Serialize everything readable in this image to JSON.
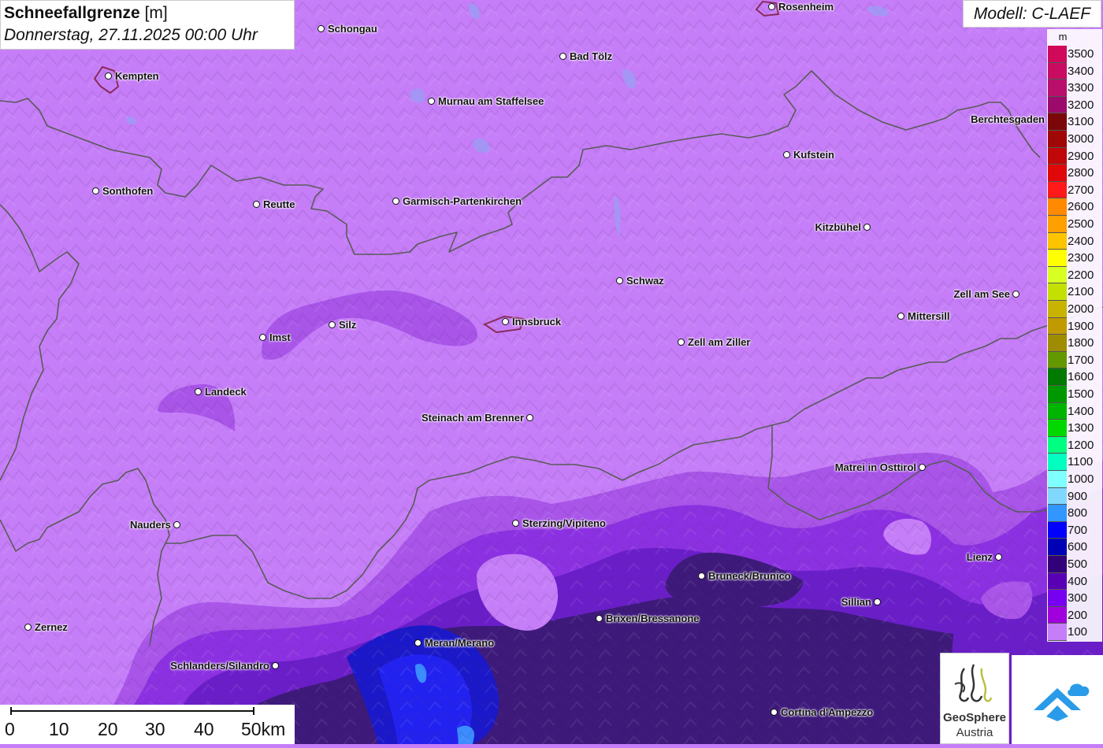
{
  "title": {
    "parameter": "Schneefallgrenze",
    "unit": "[m]",
    "datetime": "Donnerstag, 27.11.2025 00:00 Uhr"
  },
  "model": "Modell: C-LAEF",
  "legend": {
    "unit": "m",
    "entries": [
      {
        "value": "3500",
        "color": "#d1095b"
      },
      {
        "value": "3400",
        "color": "#c80c62"
      },
      {
        "value": "3300",
        "color": "#b80f6a"
      },
      {
        "value": "3200",
        "color": "#9c0b6b"
      },
      {
        "value": "3100",
        "color": "#7a0808"
      },
      {
        "value": "3000",
        "color": "#a00808"
      },
      {
        "value": "2900",
        "color": "#c00808"
      },
      {
        "value": "2800",
        "color": "#e00808"
      },
      {
        "value": "2700",
        "color": "#ff1a1a"
      },
      {
        "value": "2600",
        "color": "#ff8a00"
      },
      {
        "value": "2500",
        "color": "#ffa000"
      },
      {
        "value": "2400",
        "color": "#ffc400"
      },
      {
        "value": "2300",
        "color": "#ffff00"
      },
      {
        "value": "2200",
        "color": "#d8ff22"
      },
      {
        "value": "2100",
        "color": "#c4e000"
      },
      {
        "value": "2000",
        "color": "#c8b400"
      },
      {
        "value": "1900",
        "color": "#c09a00"
      },
      {
        "value": "1800",
        "color": "#a08c00"
      },
      {
        "value": "1700",
        "color": "#649800"
      },
      {
        "value": "1600",
        "color": "#007a00"
      },
      {
        "value": "1500",
        "color": "#009800"
      },
      {
        "value": "1400",
        "color": "#00b400"
      },
      {
        "value": "1300",
        "color": "#00d800"
      },
      {
        "value": "1200",
        "color": "#00ff80"
      },
      {
        "value": "1100",
        "color": "#00ffc0"
      },
      {
        "value": "1000",
        "color": "#80ffff"
      },
      {
        "value": "900",
        "color": "#80d8ff"
      },
      {
        "value": "800",
        "color": "#3296ff"
      },
      {
        "value": "700",
        "color": "#0000ff"
      },
      {
        "value": "600",
        "color": "#0000b4"
      },
      {
        "value": "500",
        "color": "#320078"
      },
      {
        "value": "400",
        "color": "#5a00b4"
      },
      {
        "value": "300",
        "color": "#7800f0"
      },
      {
        "value": "200",
        "color": "#a000dc"
      },
      {
        "value": "100",
        "color": "#c57ef7"
      }
    ]
  },
  "cities": [
    {
      "name": "Rosenheim",
      "dot": [
        980,
        9
      ],
      "label_side": "right"
    },
    {
      "name": "Schongau",
      "dot": [
        408,
        37
      ],
      "label_side": "right"
    },
    {
      "name": "Kempten",
      "dot": [
        138,
        97
      ],
      "label_side": "right"
    },
    {
      "name": "Bad Tölz",
      "dot": [
        715,
        72
      ],
      "label_side": "right"
    },
    {
      "name": "Murnau am Staffelsee",
      "dot": [
        548,
        129
      ],
      "label_side": "right"
    },
    {
      "name": "Berchtesgaden",
      "dot": [
        1340,
        152
      ],
      "label_side": "left"
    },
    {
      "name": "Kufstein",
      "dot": [
        999,
        197
      ],
      "label_side": "right"
    },
    {
      "name": "Sonthofen",
      "dot": [
        122,
        243
      ],
      "label_side": "right"
    },
    {
      "name": "Reutte",
      "dot": [
        326,
        260
      ],
      "label_side": "right"
    },
    {
      "name": "Garmisch-Partenkirchen",
      "dot": [
        503,
        256
      ],
      "label_side": "right"
    },
    {
      "name": "Kitzbühel",
      "dot": [
        1101,
        289
      ],
      "label_side": "left"
    },
    {
      "name": "Schwaz",
      "dot": [
        787,
        357
      ],
      "label_side": "right"
    },
    {
      "name": "Zell am See",
      "dot": [
        1290,
        374
      ],
      "label_side": "left"
    },
    {
      "name": "Mittersill",
      "dot": [
        1144,
        402
      ],
      "label_side": "right"
    },
    {
      "name": "Innsbruck",
      "dot": [
        642,
        409
      ],
      "label_side": "right"
    },
    {
      "name": "Silz",
      "dot": [
        422,
        413
      ],
      "label_side": "right"
    },
    {
      "name": "Imst",
      "dot": [
        334,
        429
      ],
      "label_side": "right"
    },
    {
      "name": "Zell am Ziller",
      "dot": [
        865,
        435
      ],
      "label_side": "right"
    },
    {
      "name": "Landeck",
      "dot": [
        252,
        498
      ],
      "label_side": "right"
    },
    {
      "name": "Steinach am Brenner",
      "dot": [
        673,
        531
      ],
      "label_side": "left"
    },
    {
      "name": "Matrei in Osttirol",
      "dot": [
        1171,
        594
      ],
      "label_side": "left"
    },
    {
      "name": "Nauders",
      "dot": [
        225,
        667
      ],
      "label_side": "left"
    },
    {
      "name": "Sterzing/Vipiteno",
      "dot": [
        655,
        665
      ],
      "label_side": "right"
    },
    {
      "name": "Lienz",
      "dot": [
        1268,
        708
      ],
      "label_side": "left"
    },
    {
      "name": "Bruneck/Brunico",
      "dot": [
        891,
        732
      ],
      "label_side": "right"
    },
    {
      "name": "Sillian",
      "dot": [
        1114,
        765
      ],
      "label_side": "left"
    },
    {
      "name": "Brixen/Bressanone",
      "dot": [
        761,
        786
      ],
      "label_side": "right"
    },
    {
      "name": "Zernez",
      "dot": [
        36,
        797
      ],
      "label_side": "right"
    },
    {
      "name": "Meran/Merano",
      "dot": [
        531,
        817
      ],
      "label_side": "right"
    },
    {
      "name": "Schlanders/Silandro",
      "dot": [
        350,
        846
      ],
      "label_side": "left"
    },
    {
      "name": "Cortina d'Ampezzo",
      "dot": [
        983,
        905
      ],
      "label_side": "right"
    }
  ],
  "scalebar": {
    "labels": [
      "0",
      "10",
      "20",
      "30",
      "40",
      "50km"
    ]
  },
  "logos": {
    "geosphere_line1": "GeoSphere",
    "geosphere_line2": "Austria"
  }
}
